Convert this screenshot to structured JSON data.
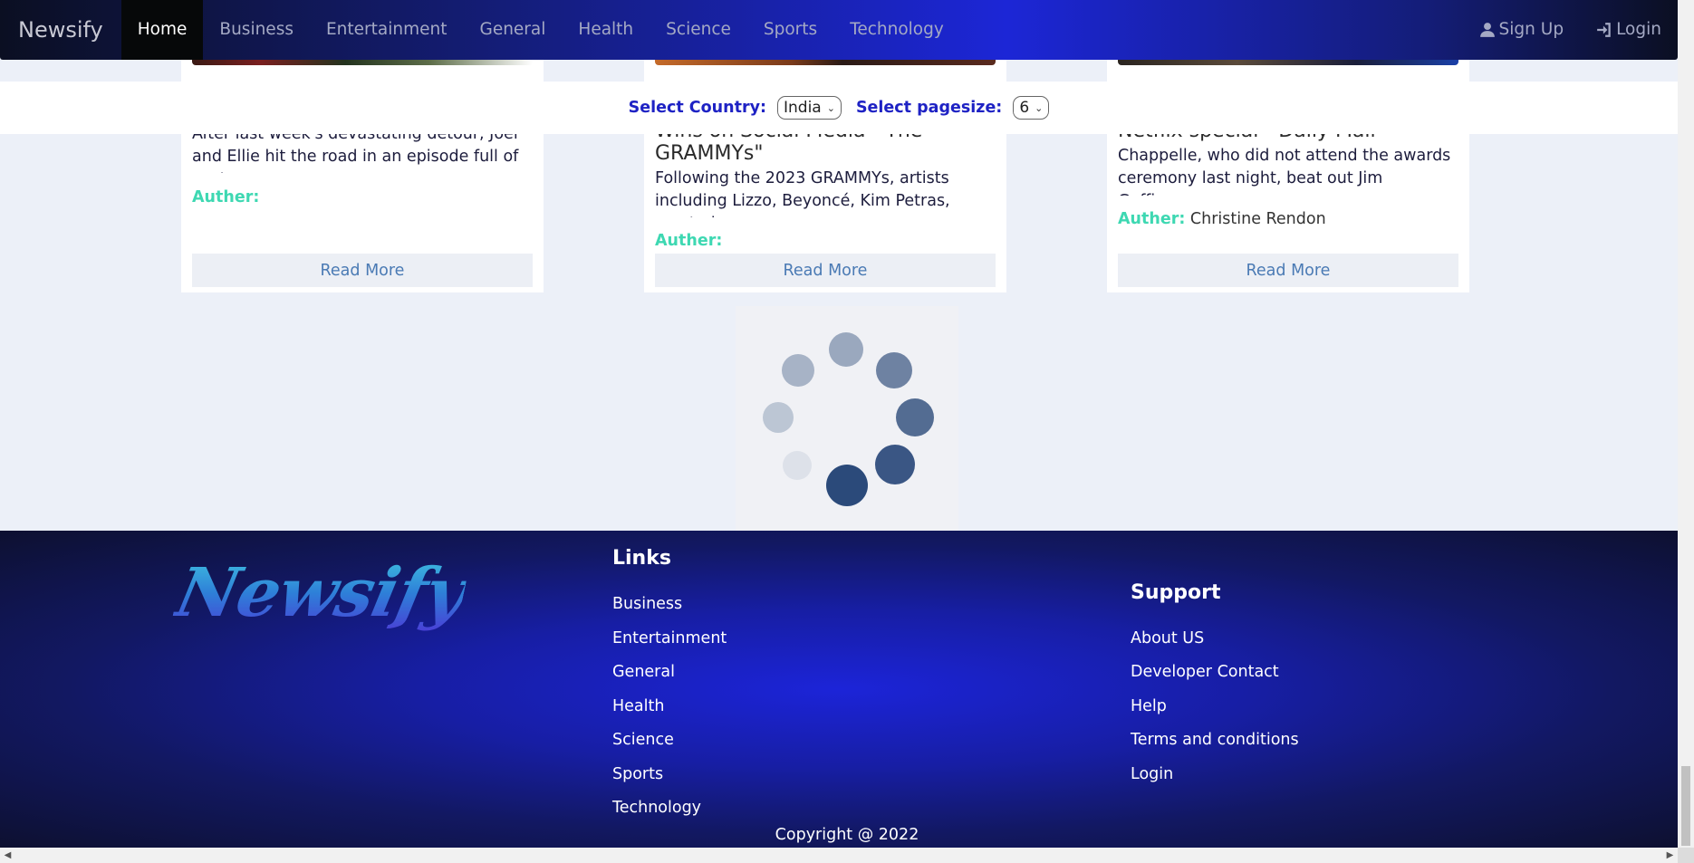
{
  "navbar": {
    "brand": "Newsify",
    "items": [
      "Home",
      "Business",
      "Entertainment",
      "General",
      "Health",
      "Science",
      "Sports",
      "Technology"
    ],
    "active": "Home",
    "signup": "Sign Up",
    "login": "Login"
  },
  "selector": {
    "country_label": "Select Country:",
    "country_value": "India",
    "pagesize_label": "Select pagesize:",
    "pagesize_value": "6"
  },
  "cards": [
    {
      "title": "",
      "description": "After last week's devastating detour, Joel and Ellie hit the road in an episode full of easter",
      "author_label": "Auther:",
      "author": "",
      "button": "Read More"
    },
    {
      "title": "Wins on Social Media - The GRAMMYs\"",
      "description": "Following the 2023 GRAMMYs, artists including Lizzo, Beyoncé, Kim Petras, reacted",
      "author_label": "Auther:",
      "author": "",
      "button": "Read More"
    },
    {
      "title": "Netflix special - Daily Mail",
      "description": "Chappelle, who did not attend the awards ceremony last night, beat out Jim Gaffigan,",
      "author_label": "Auther:",
      "author": "Christine Rendon",
      "button": "Read More"
    }
  ],
  "footer": {
    "logo": "Newsify",
    "links_title": "Links",
    "links": [
      "Business",
      "Entertainment",
      "General",
      "Health",
      "Science",
      "Sports",
      "Technology"
    ],
    "support_title": "Support",
    "support": [
      "About US",
      "Developer Contact",
      "Help",
      "Terms and conditions",
      "Login"
    ],
    "copyright": "Copyright @ 2022"
  },
  "colors": {
    "accent_label": "#1e22c4",
    "author_label": "#3ed8b2",
    "read_more_text": "#4a7ab4",
    "spinner": "#2b4a7a"
  }
}
